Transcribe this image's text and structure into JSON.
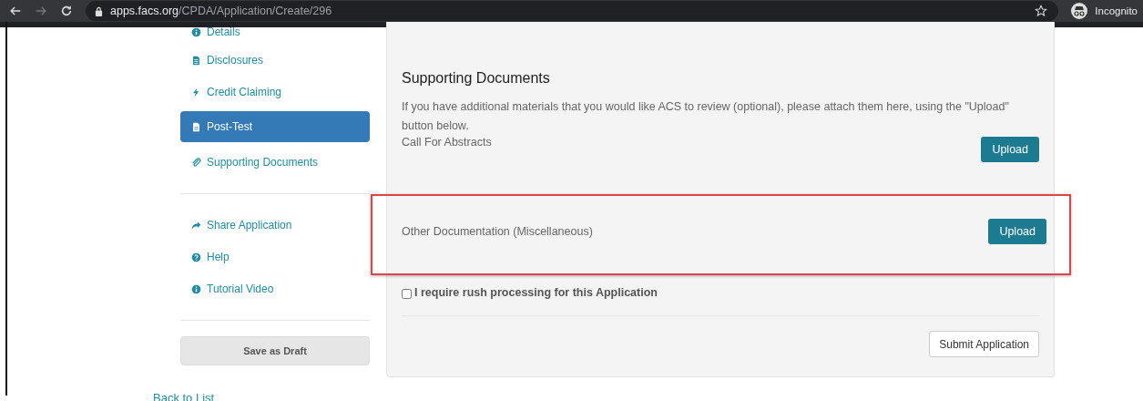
{
  "browser": {
    "url_host": "apps.facs.org",
    "url_path": "/CPDA/Application/Create/296",
    "profile": "Incognito"
  },
  "sidebar": {
    "nav_items": [
      {
        "label": "Details",
        "kind": "info",
        "selected": false
      },
      {
        "label": "Disclosures",
        "kind": "document",
        "selected": false
      },
      {
        "label": "Credit Claiming",
        "kind": "bolt",
        "selected": false
      },
      {
        "label": "Post-Test",
        "kind": "file",
        "selected": true
      },
      {
        "label": "Supporting Documents",
        "kind": "paperclip",
        "selected": false
      }
    ],
    "links": [
      {
        "label": "Share Application",
        "kind": "share"
      },
      {
        "label": "Help",
        "kind": "question"
      },
      {
        "label": "Tutorial Video",
        "kind": "info"
      }
    ],
    "save_button": "Save as Draft"
  },
  "back_link": "Back to List",
  "main": {
    "title": "Supporting Documents",
    "description": "If you have additional materials that you would like ACS to review (optional), please attach them here, using the \"Upload\" button below.",
    "uploads": [
      {
        "label": "Call For Abstracts",
        "button": "Upload",
        "highlighted": false
      },
      {
        "label": "Other Documentation (Miscellaneous)",
        "button": "Upload",
        "highlighted": true
      }
    ],
    "rush": {
      "label": "I require rush processing for this Application",
      "checked": false
    },
    "submit_button": "Submit Application"
  }
}
